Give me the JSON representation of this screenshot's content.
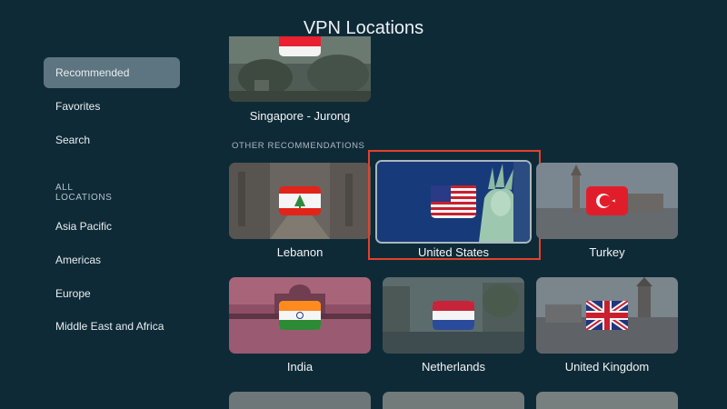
{
  "header": {
    "title": "VPN Locations"
  },
  "sidebar": {
    "items": [
      {
        "label": "Recommended"
      },
      {
        "label": "Favorites"
      },
      {
        "label": "Search"
      }
    ],
    "section_title": "ALL LOCATIONS",
    "regions": [
      {
        "label": "Asia Pacific"
      },
      {
        "label": "Americas"
      },
      {
        "label": "Europe"
      },
      {
        "label": "Middle East and Africa"
      }
    ]
  },
  "main": {
    "featured": {
      "label": "Singapore - Jurong"
    },
    "other_section_title": "OTHER RECOMMENDATIONS",
    "locations": [
      {
        "label": "Lebanon"
      },
      {
        "label": "United States"
      },
      {
        "label": "Turkey"
      },
      {
        "label": "India"
      },
      {
        "label": "Netherlands"
      },
      {
        "label": "United Kingdom"
      }
    ]
  },
  "colors": {
    "background": "#0f2a37",
    "sidebar_active": "#5d7580",
    "focus_ring": "#e4412b"
  }
}
